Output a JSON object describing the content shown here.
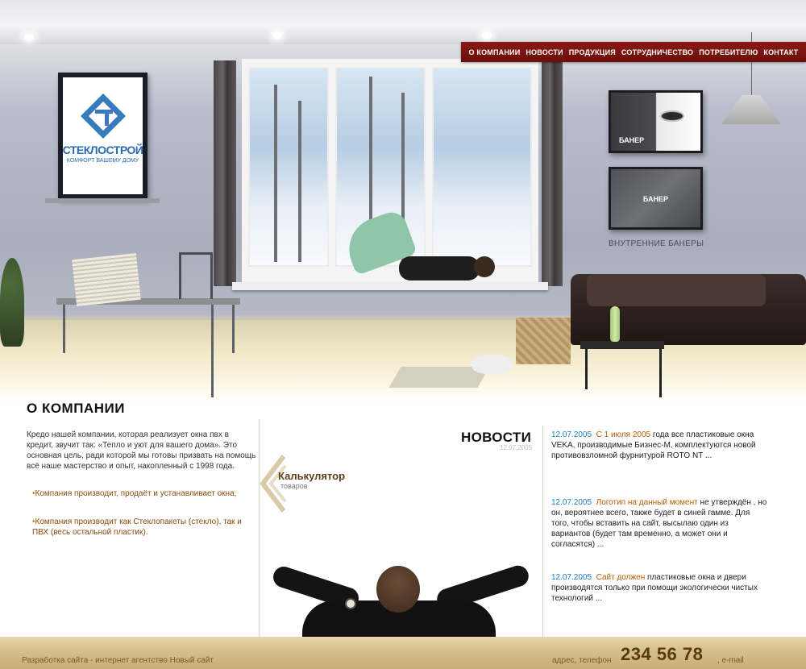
{
  "nav": {
    "items": [
      "О КОМПАНИИ",
      "НОВОСТИ",
      "ПРОДУКЦИЯ",
      "СОТРУДНИЧЕСТВО",
      "ПОТРЕБИТЕЛЮ",
      "КОНТАКТ"
    ]
  },
  "logo": {
    "name": "СТЕКЛОСТРОЙ",
    "tagline": "КОМФОРТ ВАШЕМУ ДОМУ"
  },
  "banners": {
    "banner1_label": "БАНЕР",
    "banner2_label": "БАНЕР",
    "caption": "ВНУТРЕННИЕ БАНЕРЫ"
  },
  "about": {
    "title": "О КОМПАНИИ",
    "text": "Кредо нашей компании, которая реализует окна пвх в кредит, звучит так: «Тепло и уют для вашего дома». Это основная цель, ради которой мы готовы призвать на помощь всё наше мастерство и опыт, накопленный с 1998 года.",
    "bullets": [
      "Компания производит, продаёт и    устанавливает окна;",
      "Компания производит как Стеклопакеты (стекло), так и ПВХ (весь остальной пластик)."
    ]
  },
  "calculator": {
    "title": "Калькулятор",
    "subtitle": "товаров"
  },
  "news": {
    "title": "НОВОСТИ",
    "subtitle": "12.07.2005",
    "items": [
      {
        "date": "12.07.2005",
        "headline": "С 1 июля 2005",
        "text": " года все пластиковые окна VEKA, производимые Бизнес-М, комплектуются новой противовзломной фурнитурой ROTO NT ..."
      },
      {
        "date": "12.07.2005",
        "headline": "Логотип на данный момент",
        "text": " не утверждён , но он, вероятнее всего, также будет в синей гамме. Для того, чтобы вставить на сайт, высылаю один из вариантов (будет там временно, а может они и согласятся) ..."
      },
      {
        "date": "12.07.2005",
        "headline": "Сайт должен",
        "text": " пластиковые окна и двери производятся только при помощи экологически чистых технологий ..."
      }
    ]
  },
  "footer": {
    "dev": "Разработка сайта - интернет агентство Новый сайт",
    "address_label": "адрес, телефон",
    "phone": "234 56 78",
    "email_label": ", e-mail"
  },
  "colors": {
    "nav_bg": "#7a120d",
    "brand_blue": "#2a6bb0",
    "news_date": "#1f7ec8",
    "news_headline": "#b25c00",
    "footer_text": "#7a5a22"
  }
}
